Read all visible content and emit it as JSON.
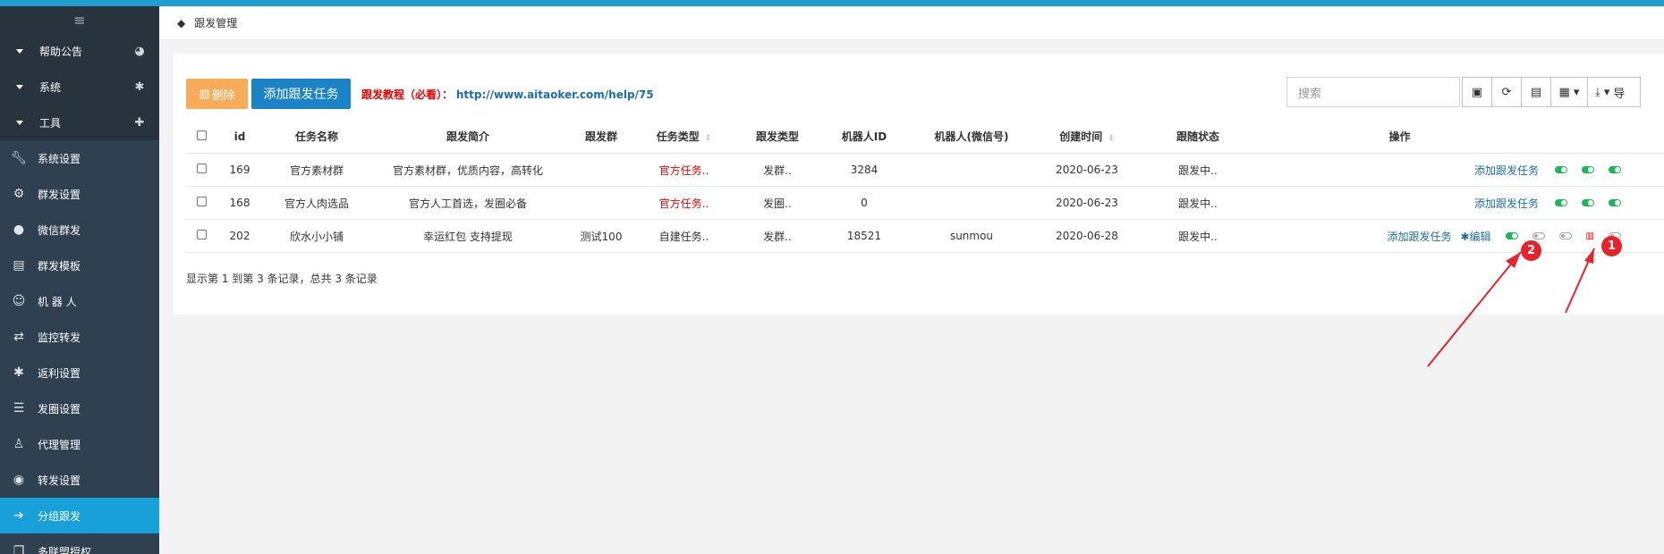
{
  "sidebar": {
    "toggle_icon": "hamburger-icon",
    "groups": [
      {
        "label": "帮助公告",
        "icon": "dashboard-icon"
      },
      {
        "label": "系统",
        "icon": "gear-icon"
      },
      {
        "label": "工具",
        "icon": "android-icon"
      }
    ],
    "items": [
      {
        "label": "系统设置",
        "icon": "wrench-icon"
      },
      {
        "label": "群发设置",
        "icon": "gears-icon"
      },
      {
        "label": "微信群发",
        "icon": "wechat-icon"
      },
      {
        "label": "群发模板",
        "icon": "file-icon"
      },
      {
        "label": "机 器 人",
        "icon": "smile-icon"
      },
      {
        "label": "监控转发",
        "icon": "retweet-icon"
      },
      {
        "label": "返利设置",
        "icon": "cog-icon"
      },
      {
        "label": "发圈设置",
        "icon": "sliders-icon"
      },
      {
        "label": "代理管理",
        "icon": "user-icon"
      },
      {
        "label": "转发设置",
        "icon": "eye-icon"
      },
      {
        "label": "分组跟发",
        "icon": "arrow-right-icon",
        "active": true
      },
      {
        "label": "多联盟授权",
        "icon": "copy-icon"
      }
    ]
  },
  "breadcrumb": {
    "label": "跟发管理",
    "icon": "tag-icon"
  },
  "toolbar": {
    "delete_label": "删除",
    "add_label": "添加跟发任务",
    "tutorial_label": "跟发教程（必看）：",
    "tutorial_link": "http://www.aitaoker.com/help/75",
    "search_placeholder": "搜索",
    "export_label": "导"
  },
  "table": {
    "headers": [
      "id",
      "任务名称",
      "跟发简介",
      "跟发群",
      "任务类型",
      "跟发类型",
      "机器人ID",
      "机器人(微信号)",
      "创建时间",
      "跟随状态",
      "操作"
    ],
    "rows": [
      {
        "id": "169",
        "name": "官方素材群",
        "intro": "官方素材群，优质内容，高转化",
        "group": "",
        "task_type": "官方任务..",
        "follow_type": "发群..",
        "robot_id": "3284",
        "robot_wx": "",
        "created": "2020-06-23",
        "status": "跟发中..",
        "op_add": "添加跟发任务",
        "op_edit": ""
      },
      {
        "id": "168",
        "name": "官方人肉选品",
        "intro": "官方人工首选，发圈必备",
        "group": "",
        "task_type": "官方任务..",
        "follow_type": "发圈..",
        "robot_id": "0",
        "robot_wx": "",
        "created": "2020-06-23",
        "status": "跟发中..",
        "op_add": "添加跟发任务",
        "op_edit": ""
      },
      {
        "id": "202",
        "name": "欣水小小铺",
        "intro": "幸运红包 支持提现",
        "group": "测试100",
        "task_type": "自建任务..",
        "follow_type": "发群..",
        "robot_id": "18521",
        "robot_wx": "sunmou",
        "created": "2020-06-28",
        "status": "跟发中..",
        "op_add": "添加跟发任务",
        "op_edit": "编辑"
      }
    ]
  },
  "summary": "显示第 1 到第 3 条记录，总共 3 条记录",
  "annotations": [
    "1",
    "2"
  ],
  "colors": {
    "accent": "#1e9fd0",
    "sidebar": "#2f4050",
    "active": "#18a0d8",
    "warning": "#f8ac59",
    "primary": "#1c84c6",
    "danger": "#ed0000",
    "toggle_on": "#19b955",
    "annotation": "#e8232a"
  }
}
